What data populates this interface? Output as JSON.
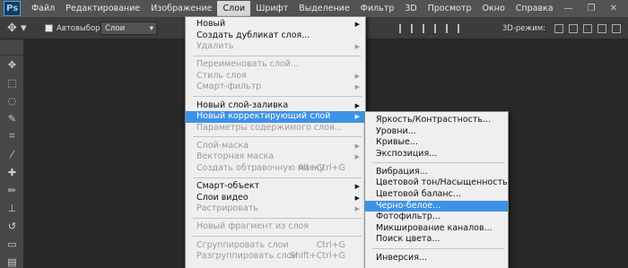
{
  "app": {
    "logo": "Ps"
  },
  "menubar": {
    "items": [
      "Файл",
      "Редактирование",
      "Изображение",
      "Слои",
      "Шрифт",
      "Выделение",
      "Фильтр",
      "3D",
      "Просмотр",
      "Окно",
      "Справка"
    ],
    "active_index": 3
  },
  "options": {
    "autoselect_label": "Автовыбор:",
    "layer_select_value": "Слои",
    "mode3d_label": "3D-режим:"
  },
  "layers_menu": {
    "items": [
      {
        "label": "Новый",
        "submenu": true
      },
      {
        "label": "Создать дубликат слоя..."
      },
      {
        "label": "Удалить",
        "submenu": true,
        "disabled": true
      },
      {
        "sep": true
      },
      {
        "label": "Переименовать слой...",
        "disabled": true
      },
      {
        "label": "Стиль слоя",
        "submenu": true,
        "disabled": true
      },
      {
        "label": "Смарт-фильтр",
        "submenu": true,
        "disabled": true
      },
      {
        "sep": true
      },
      {
        "label": "Новый слой-заливка",
        "submenu": true
      },
      {
        "label": "Новый корректирующий слой",
        "submenu": true,
        "highlight": true
      },
      {
        "label": "Параметры содержимого слоя...",
        "disabled": true
      },
      {
        "sep": true
      },
      {
        "label": "Слой-маска",
        "submenu": true,
        "disabled": true
      },
      {
        "label": "Векторная маска",
        "submenu": true,
        "disabled": true
      },
      {
        "label": "Создать обтравочную маску",
        "shortcut": "Alt+Ctrl+G",
        "disabled": true
      },
      {
        "sep": true
      },
      {
        "label": "Смарт-объект",
        "submenu": true
      },
      {
        "label": "Слои видео",
        "submenu": true
      },
      {
        "label": "Растрировать",
        "submenu": true,
        "disabled": true
      },
      {
        "sep": true
      },
      {
        "label": "Новый фрагмент из слоя",
        "disabled": true
      },
      {
        "sep": true
      },
      {
        "label": "Сгруппировать слои",
        "shortcut": "Ctrl+G",
        "disabled": true
      },
      {
        "label": "Разгруппировать слои",
        "shortcut": "Shift+Ctrl+G",
        "disabled": true
      }
    ]
  },
  "adjustment_menu": {
    "items": [
      {
        "label": "Яркость/Контрастность..."
      },
      {
        "label": "Уровни..."
      },
      {
        "label": "Кривые..."
      },
      {
        "label": "Экспозиция..."
      },
      {
        "sep": true
      },
      {
        "label": "Вибрация..."
      },
      {
        "label": "Цветовой тон/Насыщенность..."
      },
      {
        "label": "Цветовой баланс..."
      },
      {
        "label": "Черно-белое...",
        "highlight": true
      },
      {
        "label": "Фотофильтр..."
      },
      {
        "label": "Микширование каналов..."
      },
      {
        "label": "Поиск цвета..."
      },
      {
        "sep": true
      },
      {
        "label": "Инверсия..."
      }
    ]
  },
  "tools": [
    "move-icon",
    "marquee-icon",
    "lasso-icon",
    "quick-select-icon",
    "crop-icon",
    "eyedropper-icon",
    "healing-icon",
    "brush-icon",
    "stamp-icon",
    "history-brush-icon",
    "eraser-icon",
    "gradient-icon"
  ]
}
